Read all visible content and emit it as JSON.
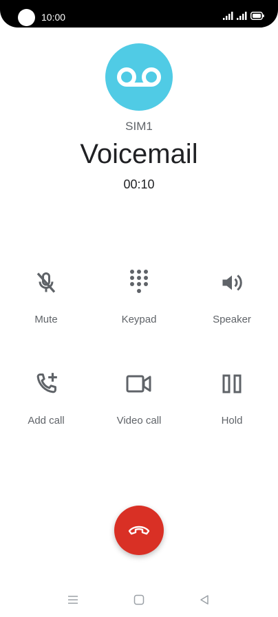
{
  "status_bar": {
    "time": "10:00"
  },
  "call": {
    "sim": "SIM1",
    "name": "Voicemail",
    "duration": "00:10"
  },
  "actions": [
    {
      "label": "Mute",
      "icon": "mic-off-icon"
    },
    {
      "label": "Keypad",
      "icon": "dialpad-icon"
    },
    {
      "label": "Speaker",
      "icon": "speaker-icon"
    },
    {
      "label": "Add call",
      "icon": "add-call-icon"
    },
    {
      "label": "Video call",
      "icon": "video-camera-icon"
    },
    {
      "label": "Hold",
      "icon": "pause-icon"
    }
  ],
  "colors": {
    "avatar": "#50cbe5",
    "end_call": "#d93025",
    "icon": "#5f6368",
    "status_bar": "#000000"
  }
}
